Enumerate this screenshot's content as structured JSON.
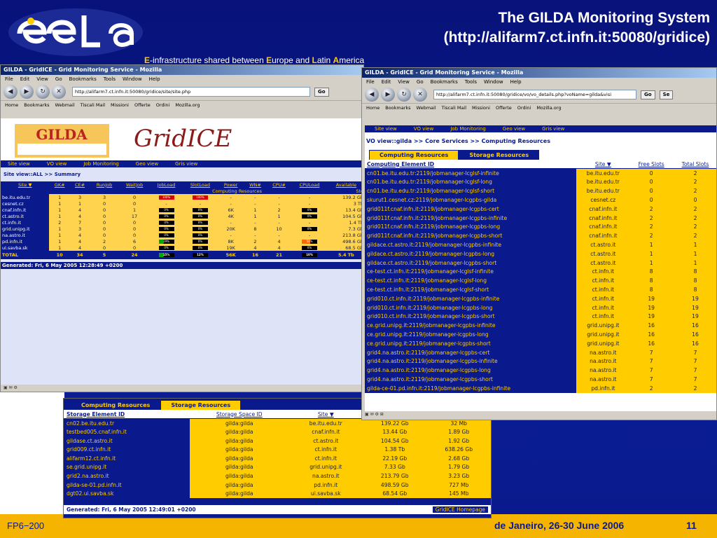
{
  "slide": {
    "title_line1": "The GILDA Monitoring System",
    "title_line2": "(http://alifarm7.ct.infn.it:50080/gridice)",
    "tagline": {
      "e1": "E",
      "t1": "-infrastructure shared between ",
      "e2": "E",
      "t2": "urope and ",
      "l": "L",
      "t3": "atin ",
      "a": "A",
      "t4": "merica"
    },
    "footer_left": "FP6−200",
    "footer_right": "de Janeiro, 26-30 June 2006",
    "page_number": "11",
    "colors": {
      "brand_blue": "#0a1a8c",
      "accent_yellow": "#ffcc00",
      "footer": "#f4b400"
    }
  },
  "window1": {
    "title": "GILDA - GridICE - Grid Monitoring Service - Mozilla",
    "menu": [
      "File",
      "Edit",
      "View",
      "Go",
      "Bookmarks",
      "Tools",
      "Window",
      "Help"
    ],
    "url": "http://alifarm7.ct.infn.it:50080/gridice/site/site.php",
    "go": "Go",
    "bookmarks": [
      "Home",
      "Bookmarks",
      "Webmail",
      "Tiscali Mail",
      "Missioni",
      "Offerte",
      "Ordini",
      "Mozilla.org"
    ],
    "nav": [
      "Site view",
      "VO view",
      "Job Monitoring",
      "Geo view",
      "Gris view"
    ],
    "breadcrumb": "Site view::ALL >> Summary",
    "caption": "Computing Resources",
    "caption_right": "Sto",
    "headers": [
      "Site ▼",
      "GK#",
      "CE#",
      "RunJob",
      "WaitJob",
      "JobLoad",
      "SlotLoad",
      "Power",
      "WN#",
      "CPU#",
      "CPULoad",
      "Available"
    ],
    "rows": [
      [
        "be.itu.edu.tr",
        "1",
        "3",
        "3",
        "0",
        "100%",
        "100%",
        "-",
        "-",
        "-",
        "-",
        "139.2 Gb"
      ],
      [
        "cesnet.cz",
        "1",
        "1",
        "0",
        "0",
        "-",
        "-",
        "-",
        "-",
        "-",
        "-",
        "3 Tb"
      ],
      [
        "cnaf.infn.it",
        "1",
        "4",
        "0",
        "1",
        "0%",
        "0%",
        "6K",
        "1",
        "2",
        "0%",
        "13.4 Gb"
      ],
      [
        "ct.astro.it",
        "1",
        "4",
        "0",
        "17",
        "0%",
        "0%",
        "4K",
        "1",
        "1",
        "0%",
        "104.5 Gb"
      ],
      [
        "ct.infn.it",
        "2",
        "7",
        "0",
        "0",
        "0%",
        "0%",
        "-",
        "-",
        "-",
        "-",
        "1.4 Tb"
      ],
      [
        "grid.unipg.it",
        "1",
        "3",
        "0",
        "0",
        "0%",
        "0%",
        "20K",
        "8",
        "10",
        "0%",
        "7.3 Gb"
      ],
      [
        "na.astro.it",
        "1",
        "4",
        "0",
        "0",
        "0%",
        "0%",
        "-",
        "-",
        "-",
        "-",
        "213.8 Gb"
      ],
      [
        "pd.infn.it",
        "1",
        "4",
        "2",
        "6",
        "29%",
        "0%",
        "8K",
        "2",
        "4",
        "50%",
        "498.6 Gb"
      ],
      [
        "ui.savba.sk",
        "1",
        "4",
        "0",
        "0",
        "0%",
        "0%",
        "19K",
        "4",
        "4",
        "0%",
        "68.5 Gb"
      ]
    ],
    "total": [
      "TOTAL",
      "10",
      "34",
      "5",
      "24",
      "15%",
      "12%",
      "56K",
      "16",
      "21",
      "10%",
      "5.4 Tb"
    ],
    "generated": "Generated: Fri, 6 May 2005 12:28:49 +0200"
  },
  "window2": {
    "title": "GILDA - GridICE - Grid Monitoring Service - Mozilla",
    "menu": [
      "File",
      "Edit",
      "View",
      "Go",
      "Bookmarks",
      "Tools",
      "Window",
      "Help"
    ],
    "url": "http://alifarm7.ct.infn.it:50080/gridice/vo/vo_details.php?voName=gilda&visi",
    "go": "Go",
    "search_btn": "Se",
    "bookmarks": [
      "Home",
      "Bookmarks",
      "Webmail",
      "Tiscali Mail",
      "Missioni",
      "Offerte",
      "Ordini",
      "Mozilla.org"
    ],
    "nav": [
      "Site view",
      "VO view",
      "Job Monitoring",
      "Geo view",
      "Gris view"
    ],
    "breadcrumb": "VO view::gilda >> Core Services >> Computing Resources",
    "tabs": [
      "Computing Resources",
      "Storage Resources"
    ],
    "headers": [
      "Computing Element ID",
      "Site ▼",
      "Free Slots",
      "Total Slots"
    ],
    "rows": [
      [
        "cn01.be.itu.edu.tr:2119/jobmanager-lcglsf-infinite",
        "be.itu.edu.tr",
        "0",
        "2"
      ],
      [
        "cn01.be.itu.edu.tr:2119/jobmanager-lcglsf-long",
        "be.itu.edu.tr",
        "0",
        "2"
      ],
      [
        "cn01.be.itu.edu.tr:2119/jobmanager-lcglsf-short",
        "be.itu.edu.tr",
        "0",
        "2"
      ],
      [
        "skurut1.cesnet.cz:2119/jobmanager-lcgpbs-gilda",
        "cesnet.cz",
        "0",
        "0"
      ],
      [
        "grid011f.cnaf.infn.it:2119/jobmanager-lcgpbs-cert",
        "cnaf.infn.it",
        "2",
        "2"
      ],
      [
        "grid011f.cnaf.infn.it:2119/jobmanager-lcgpbs-infinite",
        "cnaf.infn.it",
        "2",
        "2"
      ],
      [
        "grid011f.cnaf.infn.it:2119/jobmanager-lcgpbs-long",
        "cnaf.infn.it",
        "2",
        "2"
      ],
      [
        "grid011f.cnaf.infn.it:2119/jobmanager-lcgpbs-short",
        "cnaf.infn.it",
        "2",
        "2"
      ],
      [
        "gildace.ct.astro.it:2119/jobmanager-lcgpbs-infinite",
        "ct.astro.it",
        "1",
        "1"
      ],
      [
        "gildace.ct.astro.it:2119/jobmanager-lcgpbs-long",
        "ct.astro.it",
        "1",
        "1"
      ],
      [
        "gildace.ct.astro.it:2119/jobmanager-lcgpbs-short",
        "ct.astro.it",
        "1",
        "1"
      ],
      [
        "ce-test.ct.infn.it:2119/jobmanager-lcglsf-infinite",
        "ct.infn.it",
        "8",
        "8"
      ],
      [
        "ce-test.ct.infn.it:2119/jobmanager-lcglsf-long",
        "ct.infn.it",
        "8",
        "8"
      ],
      [
        "ce-test.ct.infn.it:2119/jobmanager-lcglsf-short",
        "ct.infn.it",
        "8",
        "8"
      ],
      [
        "grid010.ct.infn.it:2119/jobmanager-lcgpbs-infinite",
        "ct.infn.it",
        "19",
        "19"
      ],
      [
        "grid010.ct.infn.it:2119/jobmanager-lcgpbs-long",
        "ct.infn.it",
        "19",
        "19"
      ],
      [
        "grid010.ct.infn.it:2119/jobmanager-lcgpbs-short",
        "ct.infn.it",
        "19",
        "19"
      ],
      [
        "ce.grid.unipg.it:2119/jobmanager-lcgpbs-infinite",
        "grid.unipg.it",
        "16",
        "16"
      ],
      [
        "ce.grid.unipg.it:2119/jobmanager-lcgpbs-long",
        "grid.unipg.it",
        "16",
        "16"
      ],
      [
        "ce.grid.unipg.it:2119/jobmanager-lcgpbs-short",
        "grid.unipg.it",
        "16",
        "16"
      ],
      [
        "grid4.na.astro.it:2119/jobmanager-lcgpbs-cert",
        "na.astro.it",
        "7",
        "7"
      ],
      [
        "grid4.na.astro.it:2119/jobmanager-lcgpbs-infinite",
        "na.astro.it",
        "7",
        "7"
      ],
      [
        "grid4.na.astro.it:2119/jobmanager-lcgpbs-long",
        "na.astro.it",
        "7",
        "7"
      ],
      [
        "grid4.na.astro.it:2119/jobmanager-lcgpbs-short",
        "na.astro.it",
        "7",
        "7"
      ],
      [
        "gilda-ce-01.pd.infn.it:2119/jobmanager-lcgpbs-infinite",
        "pd.infn.it",
        "2",
        "2"
      ]
    ]
  },
  "window3": {
    "tabs": [
      "Computing Resources",
      "Storage Resources"
    ],
    "headers": [
      "Storage Element ID",
      "Storage Space ID",
      "Site ▼",
      "",
      ""
    ],
    "rows": [
      [
        "cn02.be.itu.edu.tr",
        "gilda:gilda",
        "be.itu.edu.tr",
        "139.22 Gb",
        "32 Mb"
      ],
      [
        "testbed005.cnaf.infn.it",
        "gilda:gilda",
        "cnaf.infn.it",
        "13.44 Gb",
        "1.89 Gb"
      ],
      [
        "gildase.ct.astro.it",
        "gilda:gilda",
        "ct.astro.it",
        "104.54 Gb",
        "1.92 Gb"
      ],
      [
        "grid009.ct.infn.it",
        "gilda:gilda",
        "ct.infn.it",
        "1.38 Tb",
        "638.26 Gb"
      ],
      [
        "alifarm12.ct.infn.it",
        "gilda:gilda",
        "ct.infn.it",
        "22.19 Gb",
        "2.68 Gb"
      ],
      [
        "se.grid.unipg.it",
        "gilda:gilda",
        "grid.unipg.it",
        "7.33 Gb",
        "1.79 Gb"
      ],
      [
        "grid2.na.astro.it",
        "gilda:gilda",
        "na.astro.it",
        "213.79 Gb",
        "3.23 Gb"
      ],
      [
        "gilda-se-01.pd.infn.it",
        "gilda:gilda",
        "pd.infn.it",
        "498.59 Gb",
        "727 Mb"
      ],
      [
        "dgt02.ui.savba.sk",
        "gilda:gilda",
        "ui.savba.sk",
        "68.54 Gb",
        "145 Mb"
      ]
    ],
    "generated": "Generated: Fri, 6 May 2005 12:49:01 +0200",
    "homepage": "GridICE Homepage"
  }
}
